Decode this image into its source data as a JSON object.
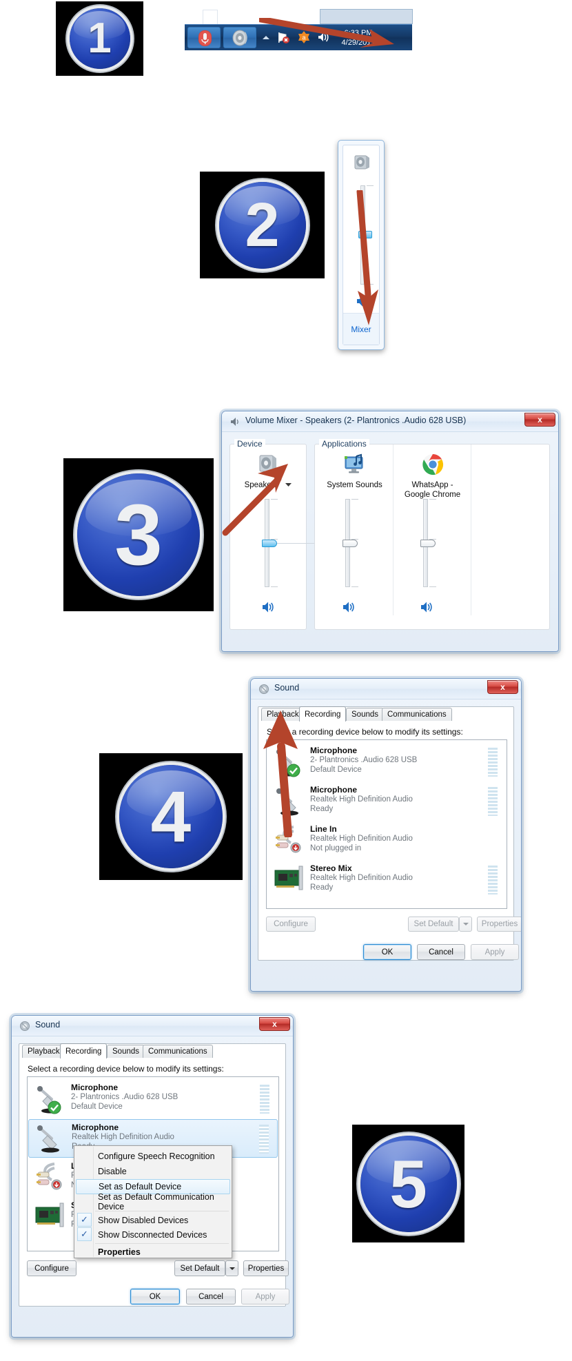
{
  "steps": [
    {
      "number": "1"
    },
    {
      "number": "2"
    },
    {
      "number": "3"
    },
    {
      "number": "4"
    },
    {
      "number": "5"
    }
  ],
  "step1": {
    "taskbar": {
      "mic_icon": "microphone-icon",
      "speaker_icon": "speaker-icon",
      "show_hidden_icon": "chevron-up-icon",
      "network_icon": "network-error-icon",
      "app_icon": "orange-app-icon",
      "volume_icon": "volume-icon",
      "clock_time": "6:33 PM",
      "clock_date": "4/29/2017"
    }
  },
  "step2": {
    "flyout": {
      "device_icon": "speaker-icon",
      "mixer_link": "Mixer",
      "slider_value": 42
    }
  },
  "step3": {
    "window": {
      "title": "Volume Mixer - Speakers (2- Plantronics .Audio 628 USB)",
      "icon": "volume-mixer-icon",
      "close_label": "x"
    },
    "device_group_label": "Device",
    "applications_group_label": "Applications",
    "device": {
      "name": "Speakers",
      "icon": "speaker-icon",
      "dropdown_icon": "chevron-down-icon",
      "slider_value": 50,
      "mute_icon": "volume-icon"
    },
    "applications": [
      {
        "name": "System Sounds",
        "icon": "system-sounds-icon",
        "slider_value": 50,
        "mute_icon": "volume-icon"
      },
      {
        "name": "WhatsApp -\nGoogle Chrome",
        "name_line1": "WhatsApp -",
        "name_line2": "Google Chrome",
        "icon": "chrome-icon",
        "slider_value": 50,
        "mute_icon": "volume-icon"
      }
    ]
  },
  "step4": {
    "window": {
      "title": "Sound",
      "icon": "sound-icon",
      "close_label": "x"
    },
    "tabs": [
      {
        "label": "Playback",
        "active": false
      },
      {
        "label": "Recording",
        "active": true
      },
      {
        "label": "Sounds",
        "active": false
      },
      {
        "label": "Communications",
        "active": false
      }
    ],
    "instruction": "Select a recording device below to modify its settings:",
    "devices": [
      {
        "name": "Microphone",
        "driver": "2- Plantronics .Audio 628 USB",
        "status": "Default Device",
        "icon": "microphone-icon",
        "badge": "default-check-badge",
        "meter": "full"
      },
      {
        "name": "Microphone",
        "driver": "Realtek High Definition Audio",
        "status": "Ready",
        "icon": "microphone-icon",
        "badge": "",
        "meter": "full"
      },
      {
        "name": "Line In",
        "driver": "Realtek High Definition Audio",
        "status": "Not plugged in",
        "icon": "line-in-icon",
        "badge": "not-plugged-badge",
        "meter": "none"
      },
      {
        "name": "Stereo Mix",
        "driver": "Realtek High Definition Audio",
        "status": "Ready",
        "icon": "sound-card-icon",
        "meter": "full"
      }
    ],
    "buttons": {
      "configure": "Configure",
      "set_default": "Set Default",
      "set_default_arrow": "chevron-down-icon",
      "properties": "Properties",
      "ok": "OK",
      "cancel": "Cancel",
      "apply": "Apply"
    }
  },
  "step5": {
    "window": {
      "title": "Sound",
      "icon": "sound-icon",
      "close_label": "x"
    },
    "tabs": [
      {
        "label": "Playback",
        "active": false
      },
      {
        "label": "Recording",
        "active": true
      },
      {
        "label": "Sounds",
        "active": false
      },
      {
        "label": "Communications",
        "active": false
      }
    ],
    "instruction": "Select a recording device below to modify its settings:",
    "devices": [
      {
        "name": "Microphone",
        "driver": "2- Plantronics .Audio 628 USB",
        "status": "Default Device",
        "icon": "microphone-icon",
        "badge": "default-check-badge",
        "selected": false
      },
      {
        "name": "Microphone",
        "driver": "Realtek High Definition Audio",
        "status": "Ready",
        "icon": "microphone-icon",
        "badge": "",
        "selected": true
      },
      {
        "name": "Line In",
        "driver": "Realtek High Definition Audio",
        "status": "Not plugged in",
        "icon": "line-in-icon",
        "badge": "not-plugged-badge",
        "selected": false
      },
      {
        "name": "Stereo Mix",
        "driver": "Realtek High Definition Audio",
        "status": "Ready",
        "icon": "sound-card-icon",
        "selected": false
      }
    ],
    "context_menu": [
      {
        "label": "Configure Speech Recognition",
        "checked": false,
        "highlighted": false,
        "bold": false
      },
      {
        "label": "Disable",
        "checked": false,
        "highlighted": false,
        "bold": false
      },
      {
        "label": "Set as Default Device",
        "checked": false,
        "highlighted": true,
        "bold": false
      },
      {
        "label": "Set as Default Communication Device",
        "checked": false,
        "highlighted": false,
        "bold": false
      },
      {
        "label": "Show Disabled Devices",
        "checked": true,
        "highlighted": false,
        "bold": false
      },
      {
        "label": "Show Disconnected Devices",
        "checked": true,
        "highlighted": false,
        "bold": false
      },
      {
        "label": "Properties",
        "checked": false,
        "highlighted": false,
        "bold": true
      }
    ],
    "buttons": {
      "configure": "Configure",
      "set_default": "Set Default",
      "set_default_arrow": "chevron-down-icon",
      "properties": "Properties",
      "ok": "OK",
      "cancel": "Cancel",
      "apply": "Apply"
    }
  },
  "colors": {
    "badge_blue": "#2a4fb8",
    "arrow_red": "#b4442b",
    "taskbar_blue": "#153b69",
    "link_blue": "#0b63ce"
  }
}
